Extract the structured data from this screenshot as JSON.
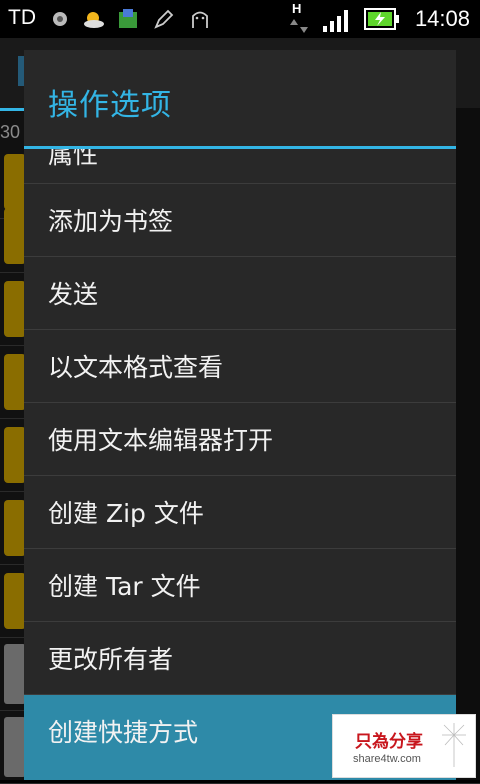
{
  "status_bar": {
    "carrier": "TD",
    "time": "14:08",
    "data_indicator": "H",
    "icons": [
      "record-icon",
      "weather-icon",
      "app-icon",
      "stylus-icon",
      "android-icon",
      "data-arrows-icon",
      "signal-icon",
      "battery-charging-icon"
    ]
  },
  "background": {
    "path_fragment": "30"
  },
  "dialog": {
    "title": "操作选项",
    "items": [
      {
        "label": "属性"
      },
      {
        "label": "添加为书签"
      },
      {
        "label": "发送"
      },
      {
        "label": "以文本格式查看"
      },
      {
        "label": "使用文本编辑器打开"
      },
      {
        "label": "创建 Zip 文件"
      },
      {
        "label": "创建 Tar 文件"
      },
      {
        "label": "更改所有者"
      },
      {
        "label": "创建快捷方式"
      }
    ],
    "selected_index": 8
  },
  "watermark": {
    "title": "只為分享",
    "url": "share4tw.com"
  },
  "colors": {
    "accent": "#33b5e5",
    "dialog_bg": "#282828",
    "selected_bg": "#2e8aa8",
    "watermark_red": "#c8161d"
  }
}
